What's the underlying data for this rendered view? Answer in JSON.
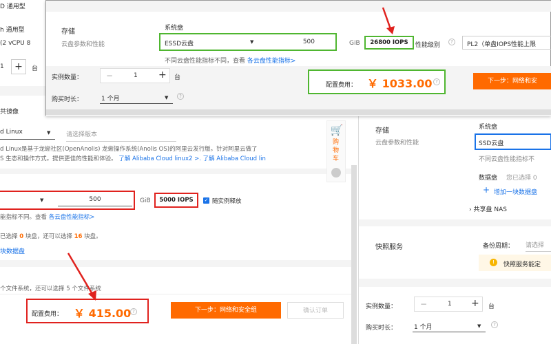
{
  "left": {
    "spec": {
      "frag1": "D 通用型",
      "frag2": "h 通用型",
      "frag3": "(2 vCPU 8"
    },
    "qty_val": "1",
    "qty_unit": "台",
    "image_tab": "共镜像",
    "os": {
      "name": "d Linux",
      "version_placeholder": "请选择版本"
    },
    "desc1": "d Linux是基于龙蜥社区(OpenAnolis) 龙蜥操作系统(Anolis OS)的阿里云发行版。针对阿里云做了",
    "desc2": "S 生态和操作方式。提供更佳的性能和体验。",
    "desc_link1": "了解 Alibaba Cloud linux2 >.",
    "desc_link2": "了解 Alibaba Cloud lin",
    "disk_size": "500",
    "gib": "GiB",
    "iops": "5000 IOPS",
    "release_label": "随实例释放",
    "perf_note_pre": "能指标不同。查看",
    "perf_link": "各云盘性能指标>",
    "data_disk_note_a": "已选择",
    "data_disk_count": "0",
    "data_disk_note_b": "块盘，还可以选择",
    "data_disk_avail": "16",
    "data_disk_note_c": "块盘。",
    "data_disk_link": "块数据盘",
    "fs_note": "个文件系统，还可以选择 5 个文件系统",
    "cost_label": "配置费用：",
    "cost": "￥ 415.00",
    "next_btn": "下一步：网络和安全组",
    "confirm_btn": "确认订单"
  },
  "top": {
    "storage_title": "存储",
    "storage_sub": "云盘参数和性能",
    "sys_disk": "系统盘",
    "disk_type": "ESSD云盘",
    "disk_size": "500",
    "gib": "GiB",
    "iops": "26800 IOPS",
    "perf_level_label": "性能级别",
    "perf_level": "PL2（单盘IOPS性能上限",
    "perf_note": "不同云盘性能指标不同，查看",
    "perf_link": "各云盘性能指标>",
    "qty_label": "实例数量：",
    "qty_minus": "−",
    "qty_val": "1",
    "qty_plus": "+",
    "qty_unit": "台",
    "duration_label": "购买时长：",
    "duration": "1 个月",
    "cost_label": "配置费用：",
    "cost": "￥ 1033.00",
    "next_btn": "下一步：网络和安"
  },
  "cart": {
    "label": "购物车"
  },
  "right": {
    "storage_title": "存储",
    "storage_sub": "云盘参数和性能",
    "sys_disk": "系统盘",
    "disk_type": "SSD云盘",
    "perf_note": "不同云盘性能指标不",
    "data_disk": "数据盘",
    "data_disk_note": "您已选择 0",
    "add_disk": "增加一块数据盘",
    "nas": "共享盘 NAS",
    "snapshot_title": "快照服务",
    "backup_label": "备份周期：",
    "backup_placeholder": "请选择",
    "snapshot_note": "快照服务能定",
    "qty_label": "实例数量：",
    "qty_minus": "−",
    "qty_val": "1",
    "qty_plus": "+",
    "qty_unit": "台",
    "duration_label": "购买时长：",
    "duration": "1 个月"
  },
  "colors": {
    "accent": "#ff6a00",
    "red_mark": "#e0221e",
    "green_mark": "#4fb630",
    "link": "#1a73e8"
  }
}
